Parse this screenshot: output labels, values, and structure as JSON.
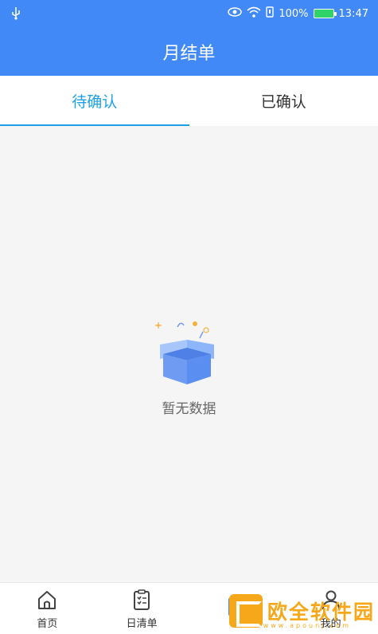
{
  "status_bar": {
    "battery_percent": "100%",
    "time": "13:47",
    "icons": [
      "usb-icon",
      "eye-icon",
      "wifi-icon",
      "sim-icon",
      "battery-icon"
    ]
  },
  "header": {
    "title": "月结单"
  },
  "tabs": [
    {
      "label": "待确认",
      "active": true
    },
    {
      "label": "已确认",
      "active": false
    }
  ],
  "empty_state": {
    "text": "暂无数据",
    "icon": "empty-box-icon"
  },
  "bottom_nav": [
    {
      "label": "首页",
      "icon": "home-icon"
    },
    {
      "label": "日清单",
      "icon": "clipboard-icon"
    },
    {
      "label": "",
      "icon": "statement-icon"
    },
    {
      "label": "我的",
      "icon": "user-icon"
    }
  ],
  "watermark": {
    "text": "欧全软件园",
    "sub": "www.apounj.com"
  },
  "colors": {
    "primary": "#4189f6",
    "tab_active": "#1ea0e6",
    "background": "#f5f5f5",
    "watermark": "#f6a81a"
  }
}
